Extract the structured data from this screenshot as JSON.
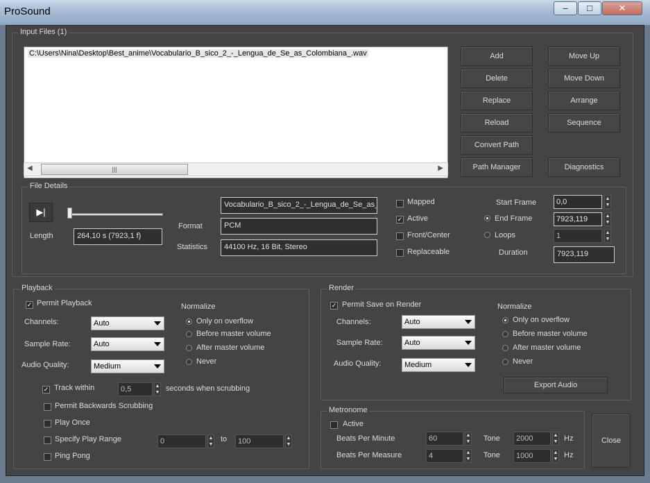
{
  "window": {
    "title": "ProSound"
  },
  "input_files": {
    "title": "Input Files (1)",
    "files": [
      "C:\\Users\\Nina\\Desktop\\Best_anime\\Vocabulario_B_sico_2_-_Lengua_de_Se_as_Colombiana_.wav"
    ],
    "scroll_grip": "|||",
    "buttons": {
      "add": "Add",
      "move_up": "Move Up",
      "delete": "Delete",
      "move_down": "Move Down",
      "replace": "Replace",
      "arrange": "Arrange",
      "reload": "Reload",
      "sequence": "Sequence",
      "convert_path": "Convert Path",
      "path_manager": "Path Manager",
      "diagnostics": "Diagnostics"
    }
  },
  "file_details": {
    "title": "File Details",
    "length_label": "Length",
    "length_value": "264,10 s (7923,1 f)",
    "filename_value": "Vocabulario_B_sico_2_-_Lengua_de_Se_as_C",
    "format_label": "Format",
    "format_value": "PCM",
    "statistics_label": "Statistics",
    "statistics_value": "44100 Hz, 16 Bit, Stereo",
    "mapped_label": "Mapped",
    "active_label": "Active",
    "front_center_label": "Front/Center",
    "replaceable_label": "Replaceable",
    "start_frame_label": "Start Frame",
    "start_frame_value": "0,0",
    "end_frame_label": "End Frame",
    "end_frame_value": "7923,119",
    "loops_label": "Loops",
    "loops_value": "1",
    "duration_label": "Duration",
    "duration_value": "7923,119",
    "active_checked": true,
    "mapped_checked": false,
    "front_center_checked": false,
    "replaceable_checked": false,
    "selected_radio": "End Frame"
  },
  "playback": {
    "title": "Playback",
    "permit_label": "Permit Playback",
    "channels_label": "Channels:",
    "channels_value": "Auto",
    "sample_rate_label": "Sample Rate:",
    "sample_rate_value": "Auto",
    "audio_quality_label": "Audio Quality:",
    "audio_quality_value": "Medium",
    "normalize_label": "Normalize",
    "normalize_options": [
      "Only on overflow",
      "Before master volume",
      "After master volume",
      "Never"
    ],
    "normalize_selected": "Only on overflow",
    "track_within_label": "Track within",
    "track_within_value": "0,5",
    "track_within_suffix": "seconds when scrubbing",
    "backwards_label": "Permit Backwards Scrubbing",
    "play_once_label": "Play Once",
    "specify_range_label": "Specify Play Range",
    "range_from": "0",
    "range_to_label": "to",
    "range_to": "100",
    "ping_pong_label": "Ping Pong"
  },
  "render": {
    "title": "Render",
    "permit_label": "Permit Save on Render",
    "channels_label": "Channels:",
    "channels_value": "Auto",
    "sample_rate_label": "Sample Rate:",
    "sample_rate_value": "Auto",
    "audio_quality_label": "Audio Quality:",
    "audio_quality_value": "Medium",
    "normalize_label": "Normalize",
    "normalize_options": [
      "Only on overflow",
      "Before master volume",
      "After master volume",
      "Never"
    ],
    "normalize_selected": "Only on overflow",
    "export_label": "Export Audio"
  },
  "metronome": {
    "title": "Metronome",
    "active_label": "Active",
    "bpm_label": "Beats Per Minute",
    "bpm_value": "60",
    "bpmeas_label": "Beats Per Measure",
    "bpmeas_value": "4",
    "tone_label": "Tone",
    "tone1_value": "2000",
    "tone2_value": "1000",
    "hz_label": "Hz"
  },
  "close_label": "Close",
  "colors": {
    "panel": "#444444",
    "titlebar": "#a9bfd6"
  }
}
